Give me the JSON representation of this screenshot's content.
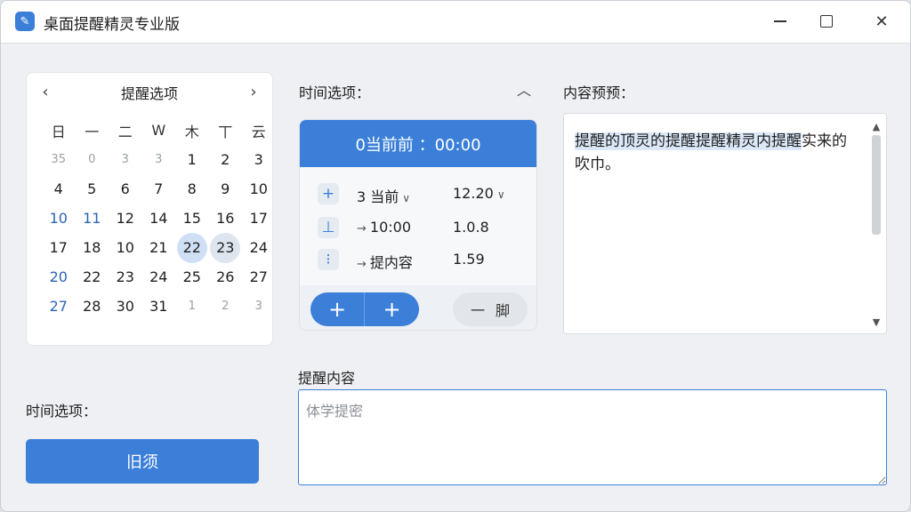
{
  "window": {
    "title": "桌面提醒精灵专业版",
    "icon": "pen-icon",
    "controls": [
      "minimize",
      "maximize",
      "close"
    ]
  },
  "calendar": {
    "title": "提醒选项",
    "prev": "‹",
    "next": "›",
    "weekdays": [
      "日",
      "一",
      "二",
      "W",
      "木",
      "丅",
      "云"
    ],
    "weeks": [
      [
        {
          "d": "35",
          "t": "muted"
        },
        {
          "d": "0",
          "t": "muted"
        },
        {
          "d": "3",
          "t": "muted"
        },
        {
          "d": "3",
          "t": "muted"
        },
        {
          "d": "1",
          "t": ""
        },
        {
          "d": "2",
          "t": ""
        },
        {
          "d": "3",
          "t": ""
        }
      ],
      [
        {
          "d": "4",
          "t": ""
        },
        {
          "d": "5",
          "t": ""
        },
        {
          "d": "6",
          "t": ""
        },
        {
          "d": "7",
          "t": ""
        },
        {
          "d": "8",
          "t": ""
        },
        {
          "d": "9",
          "t": ""
        },
        {
          "d": "10",
          "t": ""
        }
      ],
      [
        {
          "d": "10",
          "t": "blue"
        },
        {
          "d": "11",
          "t": "blue"
        },
        {
          "d": "12",
          "t": ""
        },
        {
          "d": "14",
          "t": ""
        },
        {
          "d": "15",
          "t": ""
        },
        {
          "d": "16",
          "t": ""
        },
        {
          "d": "17",
          "t": ""
        }
      ],
      [
        {
          "d": "17",
          "t": ""
        },
        {
          "d": "18",
          "t": ""
        },
        {
          "d": "10",
          "t": ""
        },
        {
          "d": "21",
          "t": ""
        },
        {
          "d": "22",
          "t": "sel"
        },
        {
          "d": "23",
          "t": "sel2"
        },
        {
          "d": "24",
          "t": ""
        }
      ],
      [
        {
          "d": "20",
          "t": "blue"
        },
        {
          "d": "22",
          "t": ""
        },
        {
          "d": "23",
          "t": ""
        },
        {
          "d": "24",
          "t": ""
        },
        {
          "d": "25",
          "t": ""
        },
        {
          "d": "26",
          "t": ""
        },
        {
          "d": "27",
          "t": ""
        }
      ],
      [
        {
          "d": "27",
          "t": "blue"
        },
        {
          "d": "28",
          "t": ""
        },
        {
          "d": "30",
          "t": ""
        },
        {
          "d": "31",
          "t": ""
        },
        {
          "d": "1",
          "t": "muted"
        },
        {
          "d": "2",
          "t": "muted"
        },
        {
          "d": "3",
          "t": "muted"
        }
      ]
    ]
  },
  "time_options": {
    "label": "时间选项：",
    "collapse": "^",
    "header": "0当前前  ：00:00",
    "rows": [
      {
        "icon": "plus-icon",
        "glyph": "+",
        "text1": "3 当前",
        "text2": "12.20",
        "chevron": true,
        "arrow": false
      },
      {
        "icon": "clock-icon",
        "glyph": "⊥",
        "text1": "10:00",
        "text2": "1.0.8",
        "chevron": false,
        "arrow": true
      },
      {
        "icon": "list-icon",
        "glyph": "⁝",
        "text1": "提内容",
        "text2": "1.59",
        "chevron": false,
        "arrow": true
      }
    ],
    "add_left": "+",
    "add_right": "+",
    "minus": "一",
    "minus_label": "脚"
  },
  "preview": {
    "label": "内容预预：",
    "text": "提醒的顶灵的提醒提醒精灵内提醒实来的吹巾。",
    "highlight": "提醒的顶灵的提醒提醒精灵内提醒"
  },
  "bottom_left": {
    "label": "时间选项：",
    "button": "旧须"
  },
  "reminder": {
    "label": "提醒内容",
    "placeholder": "体学提密"
  },
  "colors": {
    "accent": "#3b7fd9",
    "selected_day": "#cfe0f5",
    "blue_day": "#2c63b5"
  }
}
